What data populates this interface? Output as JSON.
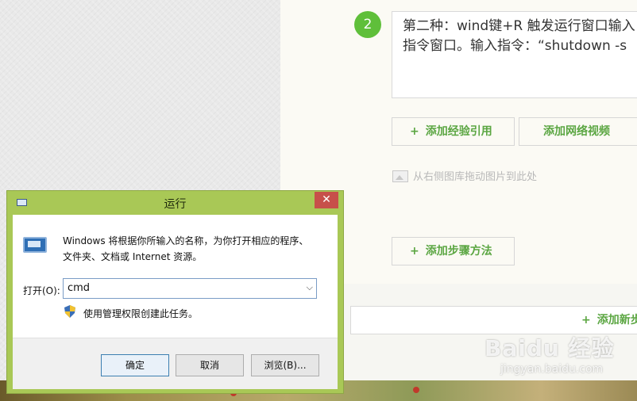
{
  "step": {
    "number": "2",
    "text_line1": "第二种：wind键+R 触发运行窗口输入",
    "text_line2": "指令窗口。输入指令：“shutdown -s"
  },
  "buttons": {
    "add_reference": "添加经验引用",
    "add_video": "添加网络视频",
    "add_step_method": "添加步骤方法",
    "add_new": "添加新步",
    "plus": "+"
  },
  "drag_hint": "从右侧图库拖动图片到此处",
  "watermark": {
    "logo": "Baidu 经验",
    "sub": "jingyan.baidu.com"
  },
  "dialog": {
    "title": "运行",
    "close": "✕",
    "desc_line1": "Windows 将根据你所输入的名称，为你打开相应的程序、",
    "desc_line2": "文件夹、文档或 Internet 资源。",
    "open_label": "打开(O):",
    "combo_value": "cmd",
    "admin_note": "使用管理权限创建此任务。",
    "ok": "确定",
    "cancel": "取消",
    "browse": "浏览(B)...",
    "accent": "#a9c856"
  },
  "colors": {
    "green": "#5fbf3a",
    "link_green": "#5ba642",
    "close_red": "#c7504a"
  }
}
